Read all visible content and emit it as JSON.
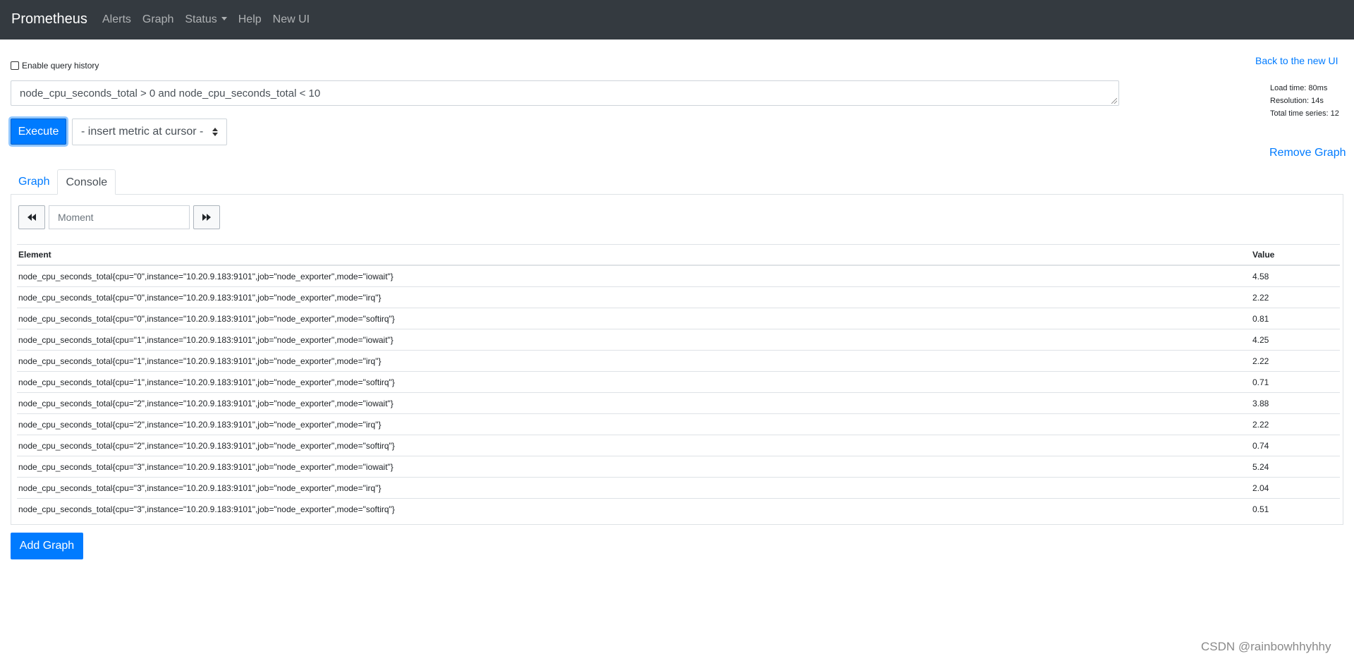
{
  "navbar": {
    "brand": "Prometheus",
    "links": [
      "Alerts",
      "Graph",
      "Status",
      "Help",
      "New UI"
    ]
  },
  "query": {
    "history_label": "Enable query history",
    "history_checked": false,
    "expression": "node_cpu_seconds_total > 0 and node_cpu_seconds_total < 10",
    "execute_label": "Execute",
    "metric_select": "- insert metric at cursor -"
  },
  "side": {
    "back_link": "Back to the new UI",
    "load_time": "Load time: 80ms",
    "resolution": "Resolution: 14s",
    "total_series": "Total time series: 12",
    "remove_graph": "Remove Graph"
  },
  "tabs": {
    "graph": "Graph",
    "console": "Console",
    "active": "Console"
  },
  "console": {
    "moment_placeholder": "Moment",
    "headers": {
      "element": "Element",
      "value": "Value"
    },
    "rows": [
      {
        "element": "node_cpu_seconds_total{cpu=\"0\",instance=\"10.20.9.183:9101\",job=\"node_exporter\",mode=\"iowait\"}",
        "value": "4.58"
      },
      {
        "element": "node_cpu_seconds_total{cpu=\"0\",instance=\"10.20.9.183:9101\",job=\"node_exporter\",mode=\"irq\"}",
        "value": "2.22"
      },
      {
        "element": "node_cpu_seconds_total{cpu=\"0\",instance=\"10.20.9.183:9101\",job=\"node_exporter\",mode=\"softirq\"}",
        "value": "0.81"
      },
      {
        "element": "node_cpu_seconds_total{cpu=\"1\",instance=\"10.20.9.183:9101\",job=\"node_exporter\",mode=\"iowait\"}",
        "value": "4.25"
      },
      {
        "element": "node_cpu_seconds_total{cpu=\"1\",instance=\"10.20.9.183:9101\",job=\"node_exporter\",mode=\"irq\"}",
        "value": "2.22"
      },
      {
        "element": "node_cpu_seconds_total{cpu=\"1\",instance=\"10.20.9.183:9101\",job=\"node_exporter\",mode=\"softirq\"}",
        "value": "0.71"
      },
      {
        "element": "node_cpu_seconds_total{cpu=\"2\",instance=\"10.20.9.183:9101\",job=\"node_exporter\",mode=\"iowait\"}",
        "value": "3.88"
      },
      {
        "element": "node_cpu_seconds_total{cpu=\"2\",instance=\"10.20.9.183:9101\",job=\"node_exporter\",mode=\"irq\"}",
        "value": "2.22"
      },
      {
        "element": "node_cpu_seconds_total{cpu=\"2\",instance=\"10.20.9.183:9101\",job=\"node_exporter\",mode=\"softirq\"}",
        "value": "0.74"
      },
      {
        "element": "node_cpu_seconds_total{cpu=\"3\",instance=\"10.20.9.183:9101\",job=\"node_exporter\",mode=\"iowait\"}",
        "value": "5.24"
      },
      {
        "element": "node_cpu_seconds_total{cpu=\"3\",instance=\"10.20.9.183:9101\",job=\"node_exporter\",mode=\"irq\"}",
        "value": "2.04"
      },
      {
        "element": "node_cpu_seconds_total{cpu=\"3\",instance=\"10.20.9.183:9101\",job=\"node_exporter\",mode=\"softirq\"}",
        "value": "0.51"
      }
    ]
  },
  "add_graph": "Add Graph",
  "watermark": "CSDN @rainbowhhyhhy",
  "colors": {
    "navbar": "#343a40",
    "primary": "#007bff"
  },
  "icons": {
    "prev": "backward-icon",
    "next": "forward-icon"
  }
}
